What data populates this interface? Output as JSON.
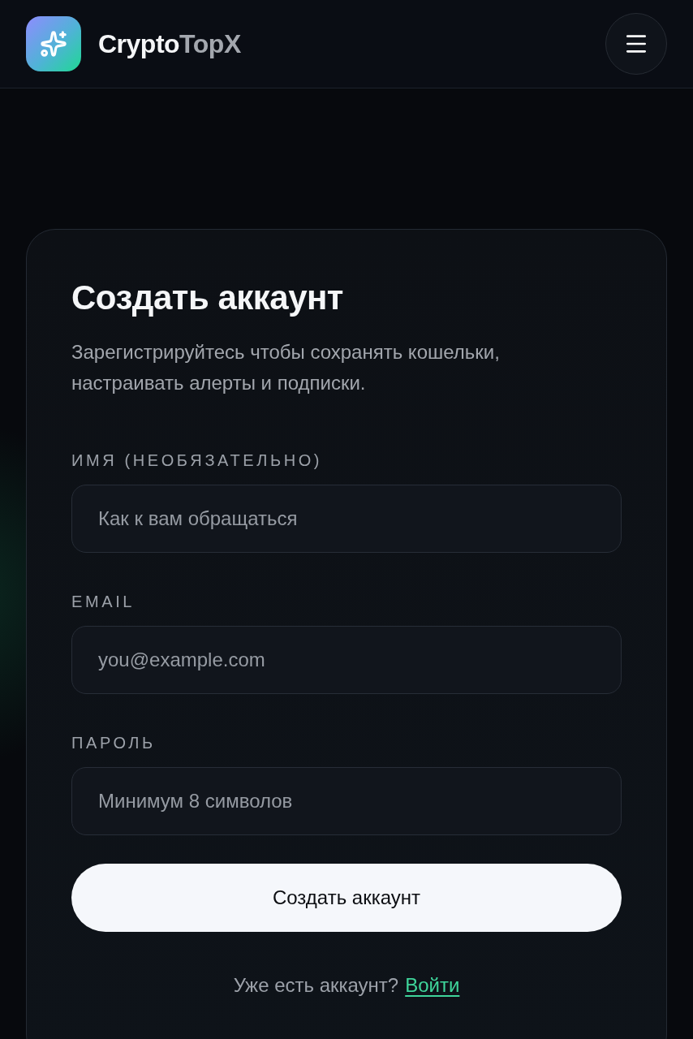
{
  "header": {
    "brand": {
      "part_1": "Crypto",
      "part_2": "TopX"
    }
  },
  "card": {
    "title": "Создать аккаунт",
    "subtitle": "Зарегистрируйтесь чтобы сохранять кошельки, настраивать алерты и подписки.",
    "fields": [
      {
        "label": "ИМЯ (НЕОБЯЗАТЕЛЬНО)",
        "placeholder": "Как к вам обращаться"
      },
      {
        "label": "EMAIL",
        "placeholder": "you@example.com"
      },
      {
        "label": "ПАРОЛЬ",
        "placeholder": "Минимум 8 символов"
      }
    ],
    "submit_button": "Создать аккаунт",
    "footer": {
      "text": "Уже есть аккаунт?",
      "link": "Войти"
    }
  }
}
